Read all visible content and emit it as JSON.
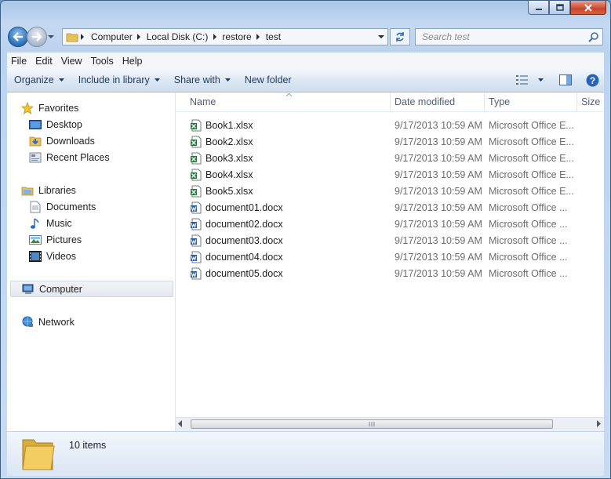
{
  "window": {
    "caption_buttons": [
      "minimize",
      "maximize",
      "close"
    ]
  },
  "address": {
    "crumbs": [
      "Computer",
      "Local Disk (C:)",
      "restore",
      "test"
    ]
  },
  "search": {
    "placeholder": "Search test"
  },
  "menu": {
    "file": "File",
    "edit": "Edit",
    "view": "View",
    "tools": "Tools",
    "help": "Help"
  },
  "toolbar": {
    "organize": "Organize",
    "include": "Include in library",
    "share": "Share with",
    "newfolder": "New folder"
  },
  "sidebar": {
    "favorites": "Favorites",
    "desktop": "Desktop",
    "downloads": "Downloads",
    "recent": "Recent Places",
    "libraries": "Libraries",
    "documents": "Documents",
    "music": "Music",
    "pictures": "Pictures",
    "videos": "Videos",
    "computer": "Computer",
    "network": "Network"
  },
  "columns": {
    "name": "Name",
    "date": "Date modified",
    "type": "Type",
    "size": "Size"
  },
  "files": [
    {
      "name": "Book1.xlsx",
      "date": "9/17/2013 10:59 AM",
      "type": "Microsoft Office E...",
      "icon": "excel-icon"
    },
    {
      "name": "Book2.xlsx",
      "date": "9/17/2013 10:59 AM",
      "type": "Microsoft Office E...",
      "icon": "excel-icon"
    },
    {
      "name": "Book3.xlsx",
      "date": "9/17/2013 10:59 AM",
      "type": "Microsoft Office E...",
      "icon": "excel-icon"
    },
    {
      "name": "Book4.xlsx",
      "date": "9/17/2013 10:59 AM",
      "type": "Microsoft Office E...",
      "icon": "excel-icon"
    },
    {
      "name": "Book5.xlsx",
      "date": "9/17/2013 10:59 AM",
      "type": "Microsoft Office E...",
      "icon": "excel-icon"
    },
    {
      "name": "document01.docx",
      "date": "9/17/2013 10:59 AM",
      "type": "Microsoft Office ...",
      "icon": "word-icon"
    },
    {
      "name": "document02.docx",
      "date": "9/17/2013 10:59 AM",
      "type": "Microsoft Office ...",
      "icon": "word-icon"
    },
    {
      "name": "document03.docx",
      "date": "9/17/2013 10:59 AM",
      "type": "Microsoft Office ...",
      "icon": "word-icon"
    },
    {
      "name": "document04.docx",
      "date": "9/17/2013 10:59 AM",
      "type": "Microsoft Office ...",
      "icon": "word-icon"
    },
    {
      "name": "document05.docx",
      "date": "9/17/2013 10:59 AM",
      "type": "Microsoft Office ...",
      "icon": "word-icon"
    }
  ],
  "status": {
    "count": "10 items"
  }
}
